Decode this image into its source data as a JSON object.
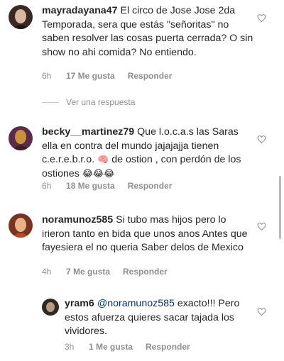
{
  "comments": [
    {
      "username": "mayradayana47",
      "text": "El circo de Jose Jose 2da Temporada, sera que estás \"señoritas\" no saben resolver las cosas puerta cerrada? O sin show  no ahi comida? No entiendo.",
      "time": "6h",
      "likes": "17 Me gusta",
      "reply": "Responder",
      "avatar_colors": [
        "#3a2a22",
        "#d8b7a3"
      ]
    },
    {
      "username": "becky__martinez79",
      "text_before": "Que l.o.c.a.s las Saras ella en contra del mundo jajajajja tienen c.e.r.e.b.r.o.",
      "emoji_brain": "🧠",
      "text_middle": "de ostion , con perdón de los ostiones",
      "emoji_laugh": "😂😂😂",
      "time": "6h",
      "likes": "18 Me gusta",
      "reply": "Responder",
      "avatar_colors": [
        "#5a2c4a",
        "#c8913a"
      ]
    },
    {
      "username": "noramunoz585",
      "text": "Si tubo  mas hijos  pero lo irieron  tanto en bida  que  unos  anos Antes  que fayesiera  el no queria  Saber delos de Mexico",
      "time": "4h",
      "likes": "7 Me gusta",
      "reply": "Responder",
      "avatar_colors": [
        "#7a3320",
        "#e7b48a"
      ]
    }
  ],
  "view_replies": "Ver una respuesta",
  "reply_comment": {
    "username": "yram6",
    "mention": "@noramunoz585",
    "text": "exacto!!! Pero estos afuerza quieres sacar tajada los vividores.",
    "time": "3h",
    "likes": "1 Me gusta",
    "reply": "Responder",
    "avatar_colors": [
      "#2d2a26",
      "#b79b82"
    ]
  }
}
